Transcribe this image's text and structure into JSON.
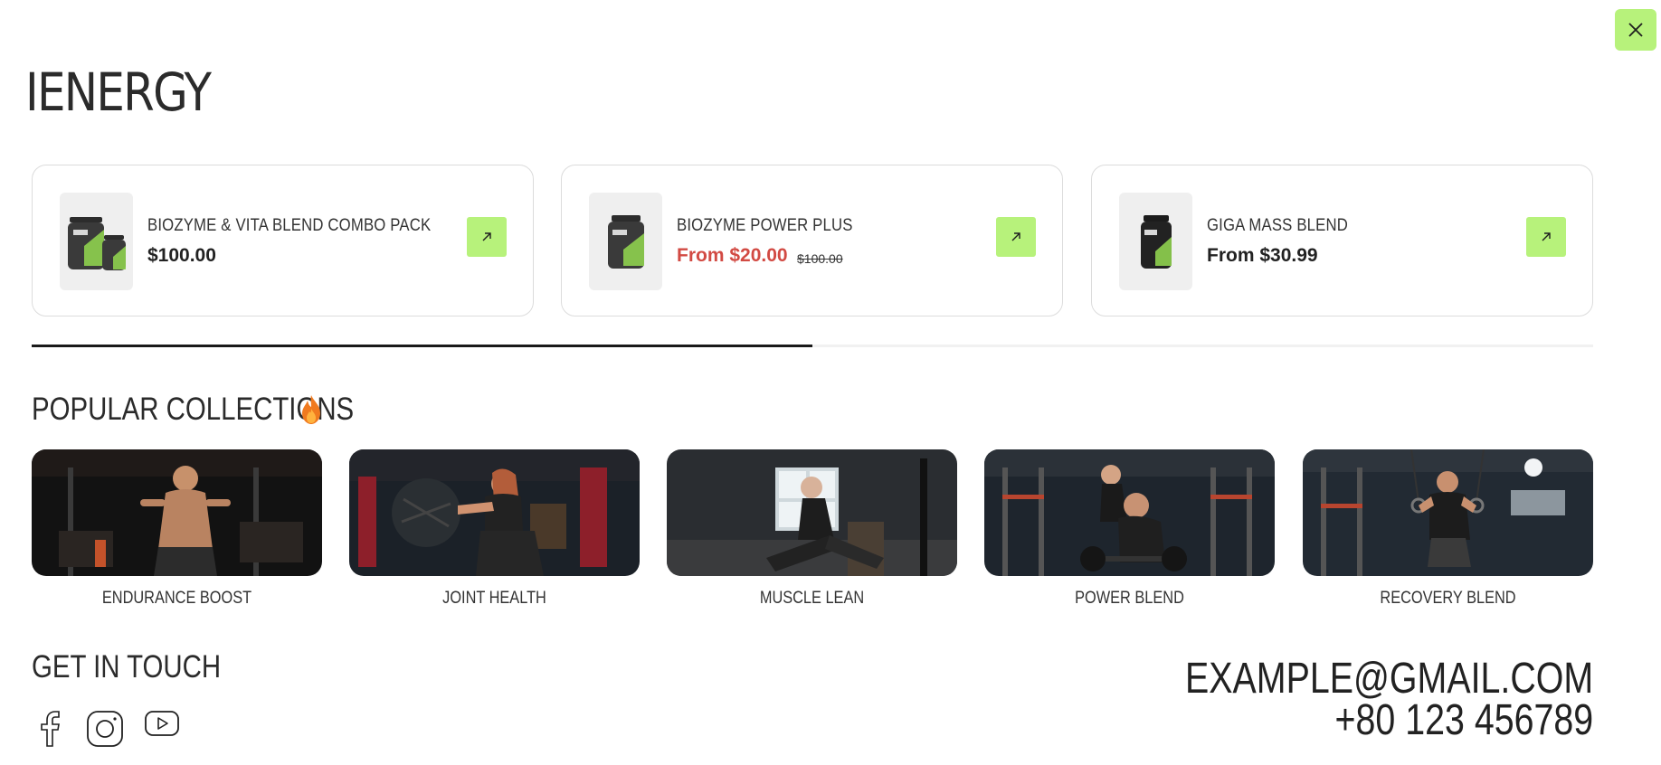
{
  "brand": {
    "name": "IENERGY"
  },
  "close": {
    "icon": "close-icon"
  },
  "products": [
    {
      "name": "BIOZYME & VITA BLEND COMBO PACK",
      "price": "$100.00",
      "compare_price": "",
      "on_sale": false,
      "icon": "supplement-jar-pack-icon"
    },
    {
      "name": "BIOZYME POWER PLUS",
      "price": "From $20.00",
      "compare_price": "$100.00",
      "on_sale": true,
      "icon": "supplement-jar-icon"
    },
    {
      "name": "GIGA MASS BLEND",
      "price": "From $30.99",
      "compare_price": "",
      "on_sale": false,
      "icon": "supplement-jar-icon"
    }
  ],
  "carousel": {
    "progress": 0.5
  },
  "popular": {
    "title": "POPULAR COLLECTIONS",
    "title_icon": "fire-icon",
    "collections": [
      {
        "label": "ENDURANCE BOOST"
      },
      {
        "label": "JOINT HEALTH"
      },
      {
        "label": "MUSCLE LEAN"
      },
      {
        "label": "POWER BLEND"
      },
      {
        "label": "RECOVERY BLEND"
      }
    ]
  },
  "contact": {
    "title": "GET IN TOUCH",
    "email": "EXAMPLE@GMAIL.COM",
    "phone": "+80 123 456789",
    "social": [
      "facebook-icon",
      "instagram-icon",
      "youtube-icon"
    ]
  },
  "colors": {
    "accent": "#b7f27b",
    "sale": "#d24a43",
    "text": "#222222"
  }
}
